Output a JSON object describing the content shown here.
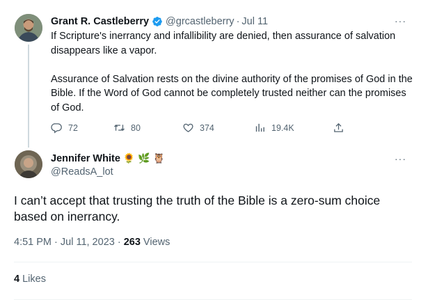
{
  "tweet1": {
    "name": "Grant R. Castleberry",
    "handle": "@grcastleberry",
    "separator": "·",
    "date": "Jul 11",
    "more": "···",
    "body_p1": "If Scripture's inerrancy and infallibility are denied, then assurance of salvation disappears like a vapor.",
    "body_p2": "Assurance of Salvation rests on the divine authority of the promises of God in the Bible. If the Word of God cannot be completely trusted neither can the promises of God.",
    "actions": {
      "replies": "72",
      "retweets": "80",
      "likes": "374",
      "views": "19.4K"
    },
    "icons": {
      "reply": "reply-icon",
      "retweet": "retweet-icon",
      "like": "heart-icon",
      "views": "views-icon",
      "share": "share-icon",
      "verified": "verified-badge-icon"
    }
  },
  "tweet2": {
    "name": "Jennifer White",
    "emojis": [
      "🌻",
      "🌿",
      "🦉"
    ],
    "handle": "@ReadsA_lot",
    "more": "···",
    "body": "I can’t accept that trusting the truth of the Bible is a zero-sum choice based on inerrancy.",
    "time": "4:51 PM · Jul 11, 2023 · ",
    "views_count": "263",
    "views_label": " Views",
    "likes_count": "4",
    "likes_label": " Likes"
  },
  "colors": {
    "text": "#0f1419",
    "secondary": "#536471",
    "verified": "#1d9bf0",
    "divider": "#eff3f4",
    "thread_line": "#cfd9de"
  }
}
